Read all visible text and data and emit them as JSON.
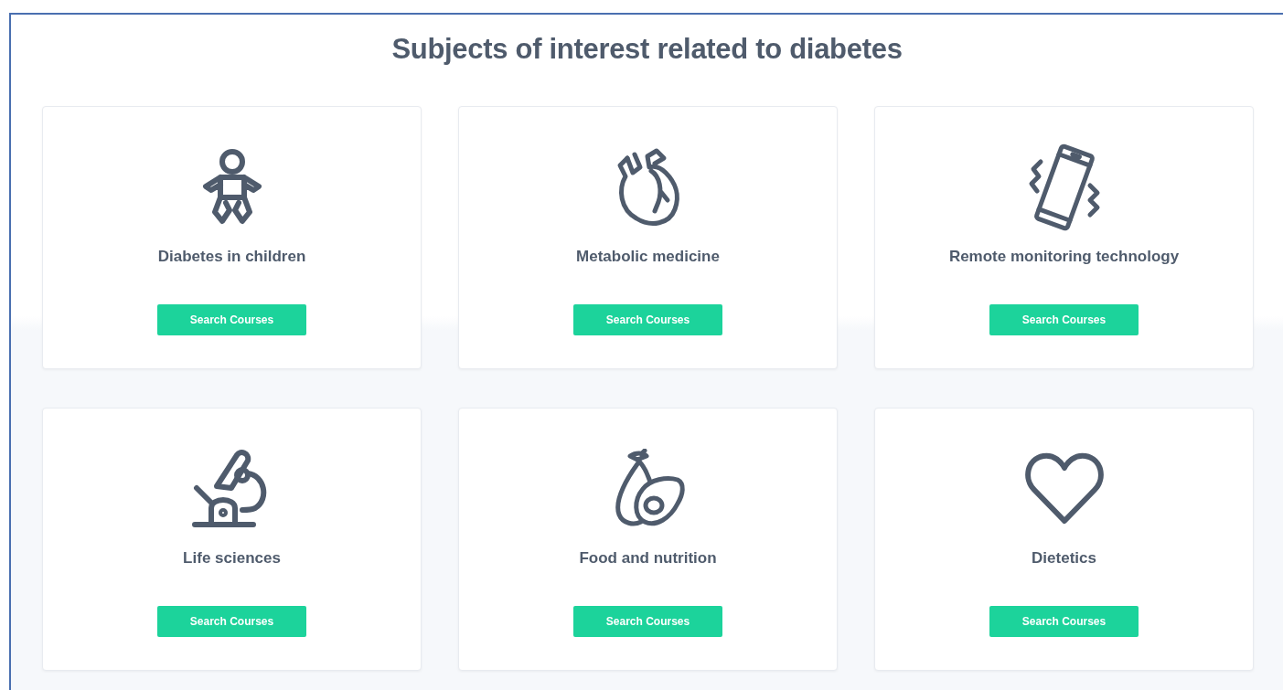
{
  "heading": "Subjects of interest related to diabetes",
  "subjects": [
    {
      "kind": "baby",
      "title": "Diabetes in children",
      "button": "Search Courses"
    },
    {
      "kind": "heart",
      "title": "Metabolic medicine",
      "button": "Search Courses"
    },
    {
      "kind": "phone",
      "title": "Remote monitoring technology",
      "button": "Search Courses"
    },
    {
      "kind": "microscope",
      "title": "Life sciences",
      "button": "Search Courses"
    },
    {
      "kind": "avocado",
      "title": "Food and nutrition",
      "button": "Search Courses"
    },
    {
      "kind": "heart-outline",
      "title": "Dietetics",
      "button": "Search Courses"
    }
  ]
}
